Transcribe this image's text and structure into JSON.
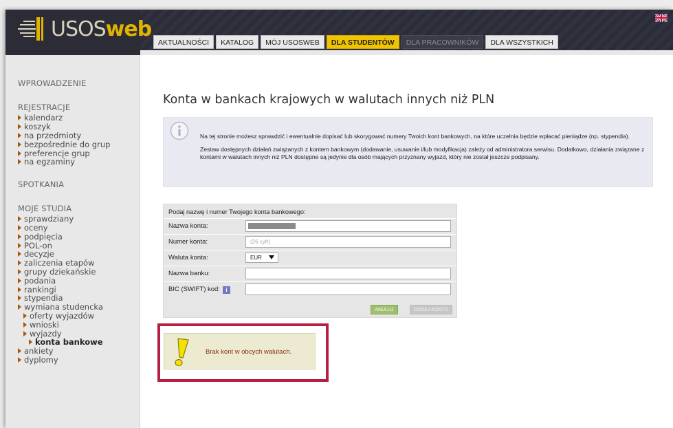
{
  "brand": {
    "logo_part1": "USOS",
    "logo_part2": "web"
  },
  "nav": {
    "tabs": [
      {
        "label": "AKTUALNOŚCI",
        "state": "normal"
      },
      {
        "label": "KATALOG",
        "state": "normal"
      },
      {
        "label": "MÓJ USOSWEB",
        "state": "normal"
      },
      {
        "label": "DLA STUDENTÓW",
        "state": "active"
      },
      {
        "label": "DLA PRACOWNIKÓW",
        "state": "disabled"
      },
      {
        "label": "DLA WSZYSTKICH",
        "state": "normal"
      }
    ],
    "language_flag": "uk-flag-icon"
  },
  "sidebar": {
    "wprowadzenie": "WPROWADZENIE",
    "rejestracje": {
      "title": "REJESTRACJE",
      "items": [
        "kalendarz",
        "koszyk",
        "na przedmioty",
        "bezpośrednie do grup",
        "preferencje grup",
        "na egzaminy"
      ]
    },
    "spotkania": "SPOTKANIA",
    "moje_studia": {
      "title": "MOJE STUDIA",
      "items": [
        "sprawdziany",
        "oceny",
        "podpięcia",
        "POL-on",
        "decyzje",
        "zaliczenia etapów",
        "grupy dziekańskie",
        "podania",
        "rankingi",
        "stypendia",
        "wymiana studencka"
      ],
      "wymiana_sub": [
        "oferty wyjazdów",
        "wnioski",
        "wyjazdy"
      ],
      "wyjazdy_sub": [
        "konta bankowe"
      ],
      "items_after": [
        "ankiety",
        "dyplomy"
      ]
    }
  },
  "main": {
    "title": "Konta w bankach krajowych w walutach innych niż PLN",
    "info": {
      "p1": "Na tej stronie możesz sprawdzić i ewentualnie dopisać lub skorygować numery Twoich kont bankowych, na które uczelnia będzie wpłacać pieniądze (np. stypendia).",
      "p2": "Zestaw dostępnych działań związanych z kontem bankowym (dodawanie, usuwanie i/lub modyfikacja) zależy od administratora serwisu. Dodatkowo, działania związane z kontami w walutach innych niż PLN dostępne są jedynie dla osób mających przyznany wyjazd, który nie został jeszcze podpisany."
    },
    "form": {
      "title": "Podaj nazwę i numer Twojego konta bankowego:",
      "nazwa_konta_label": "Nazwa konta:",
      "numer_konta_label": "Numer konta:",
      "numer_konta_placeholder": "(26 cyfr)",
      "waluta_label": "Waluta konta:",
      "waluta_value": "EUR",
      "nazwa_banku_label": "Nazwa banku:",
      "bic_label": "BIC (SWIFT) kod:",
      "bic_help": "i",
      "cancel_label": "ANULUJ",
      "add_label": "DODAJ KONTO"
    },
    "warning": "Brak kont w obcych walutach."
  },
  "colors": {
    "accent": "#f0c400",
    "header": "#2e2f3b",
    "highlight_outline": "#b52043"
  }
}
